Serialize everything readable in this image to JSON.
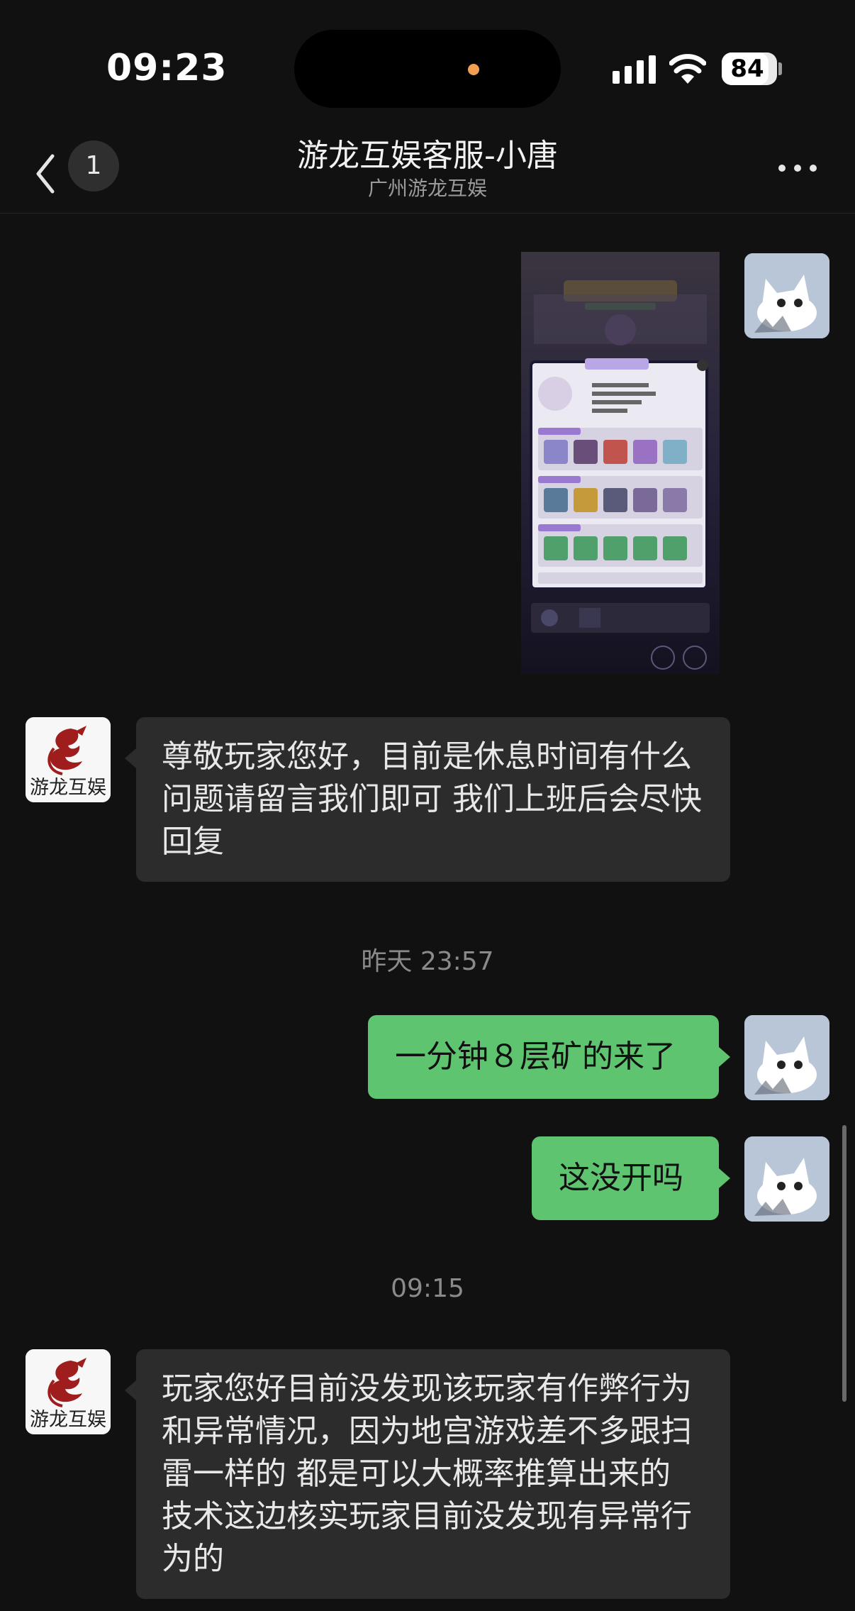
{
  "status_bar": {
    "time": "09:23",
    "battery": "84",
    "battery_level": 0.84
  },
  "nav": {
    "unread_count": "1",
    "title": "游龙互娱客服-小唐",
    "subtitle": "广州游龙互娱"
  },
  "logo_text": "游龙互娱",
  "messages": [
    {
      "kind": "image",
      "from": "self"
    },
    {
      "kind": "text",
      "from": "cs",
      "text": "尊敬玩家您好，目前是休息时间有什么问题请留言我们即可 我们上班后会尽快回复"
    },
    {
      "kind": "time",
      "text": "昨天 23:57"
    },
    {
      "kind": "text",
      "from": "self",
      "text": "一分钟８层矿的来了"
    },
    {
      "kind": "text",
      "from": "self",
      "text": "这没开吗"
    },
    {
      "kind": "time",
      "text": "09:15"
    },
    {
      "kind": "text",
      "from": "cs",
      "text": "玩家您好目前没发现该玩家有作弊行为和异常情况，因为地宫游戏差不多跟扫雷一样的 都是可以大概率推算出来的 技术这边核实玩家目前没发现有异常行为的"
    }
  ]
}
